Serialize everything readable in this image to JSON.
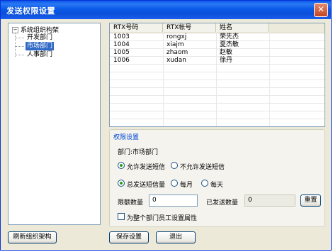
{
  "window": {
    "title": "发送权限设置",
    "close_glyph": "✕"
  },
  "tree": {
    "expand_glyph": "−",
    "root_label": "系统组织构架",
    "children": [
      "开发部门",
      "市场部门",
      "人事部门"
    ],
    "selected": "市场部门"
  },
  "table": {
    "columns": [
      "RTX号码",
      "RTX帐号",
      "姓名"
    ],
    "rows": [
      [
        "1003",
        "rongxj",
        "荣先杰"
      ],
      [
        "1004",
        "xiajm",
        "夏杰敏"
      ],
      [
        "1005",
        "zhaom",
        "赵敏"
      ],
      [
        "1006",
        "xudan",
        "徐丹"
      ]
    ]
  },
  "permissions": {
    "group_title": "权限设置",
    "department_label": "部门:市场部门",
    "allow_sms": {
      "label": "允许发送短信",
      "checked": true
    },
    "deny_sms": {
      "label": "不允许发送短信",
      "checked": false
    },
    "total_sms": {
      "label": "总发送短信量",
      "checked": true
    },
    "monthly": {
      "label": "每月",
      "checked": false
    },
    "daily": {
      "label": "每天",
      "checked": false
    },
    "limit_label": "限额数量",
    "limit_value": "0",
    "sent_label": "已发送数量",
    "sent_value": "0",
    "reset_label": "重置",
    "apply_all_label": "为整个部门员工设置属性",
    "apply_all_checked": false
  },
  "buttons": {
    "refresh": "刷新组织架构",
    "save": "保存设置",
    "exit": "退出"
  },
  "colors": {
    "titlebar": "#0a5ae8",
    "selection": "#316ac5",
    "group_title": "#0046d5",
    "radio_dot": "#21a121"
  }
}
